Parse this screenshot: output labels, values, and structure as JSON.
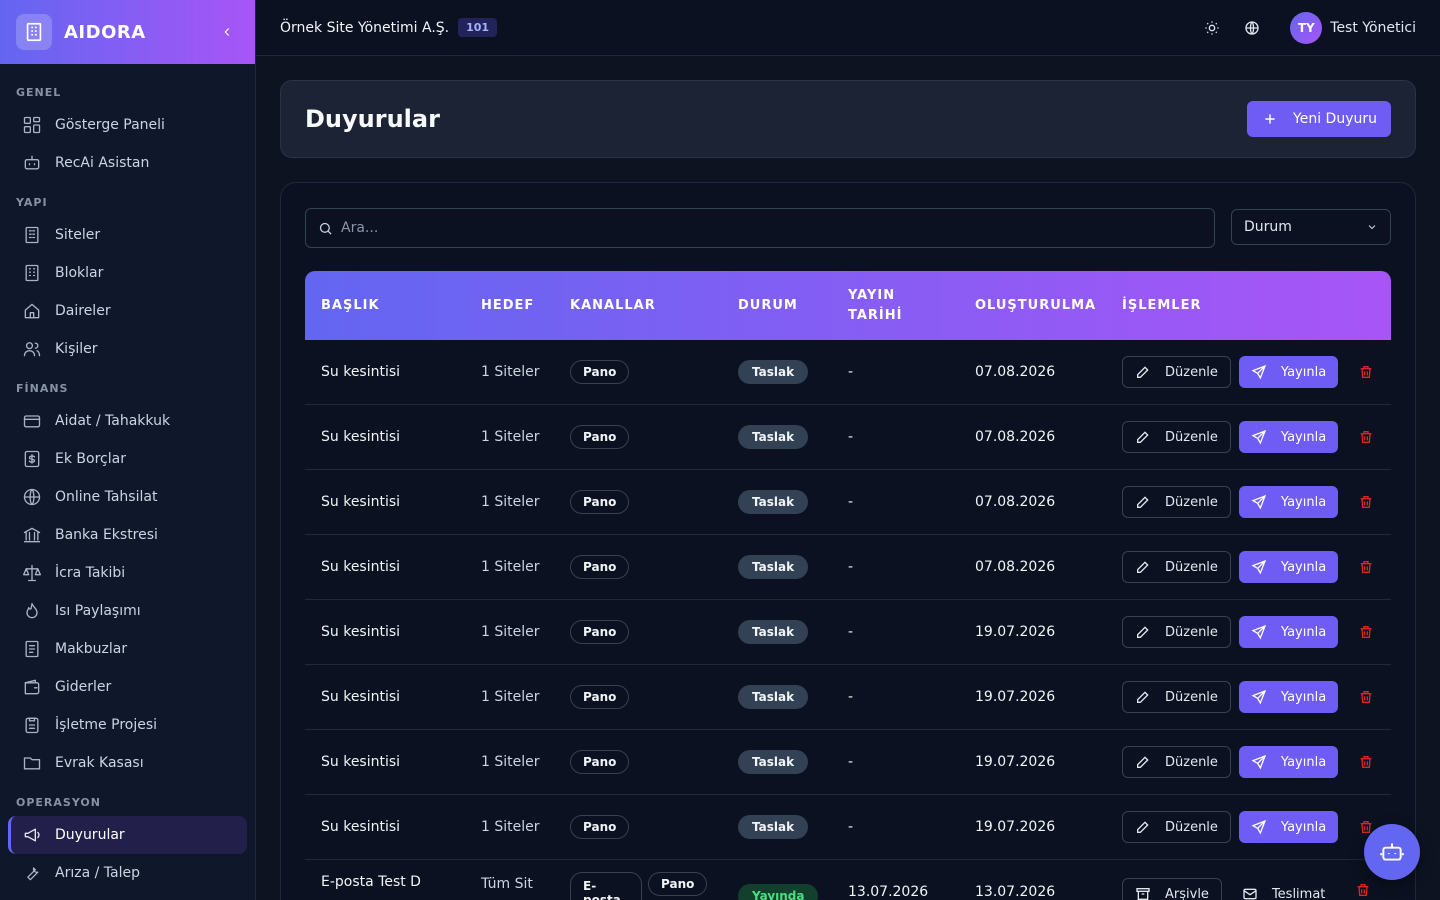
{
  "app": {
    "name": "AIDORA"
  },
  "sidebar": {
    "sections": [
      {
        "title": "GENEL",
        "items": [
          {
            "label": "Gösterge Paneli",
            "icon": "dashboard-icon"
          },
          {
            "label": "RecAi Asistan",
            "icon": "bot-icon"
          }
        ]
      },
      {
        "title": "YAPI",
        "items": [
          {
            "label": "Siteler",
            "icon": "building-icon"
          },
          {
            "label": "Bloklar",
            "icon": "block-icon"
          },
          {
            "label": "Daireler",
            "icon": "home-icon"
          },
          {
            "label": "Kişiler",
            "icon": "users-icon"
          }
        ]
      },
      {
        "title": "FİNANS",
        "items": [
          {
            "label": "Aidat / Tahakkuk",
            "icon": "card-icon"
          },
          {
            "label": "Ek Borçlar",
            "icon": "dollar-icon"
          },
          {
            "label": "Online Tahsilat",
            "icon": "globe-icon"
          },
          {
            "label": "Banka Ekstresi",
            "icon": "bank-icon"
          },
          {
            "label": "İcra Takibi",
            "icon": "scale-icon"
          },
          {
            "label": "Isı Paylaşımı",
            "icon": "flame-icon"
          },
          {
            "label": "Makbuzlar",
            "icon": "receipt-icon"
          },
          {
            "label": "Giderler",
            "icon": "wallet-icon"
          },
          {
            "label": "İşletme Projesi",
            "icon": "clipboard-icon"
          },
          {
            "label": "Evrak Kasası",
            "icon": "folder-icon"
          }
        ]
      },
      {
        "title": "OPERASYON",
        "items": [
          {
            "label": "Duyurular",
            "icon": "megaphone-icon",
            "active": true
          },
          {
            "label": "Arıza / Talep",
            "icon": "wrench-icon"
          }
        ]
      }
    ]
  },
  "topbar": {
    "org_name": "Örnek Site Yönetimi A.Ş.",
    "org_badge": "101",
    "user_initials": "TY",
    "user_name": "Test Yönetici"
  },
  "header": {
    "title": "Duyurular",
    "new_button": "Yeni Duyuru"
  },
  "filters": {
    "search_placeholder": "Ara...",
    "status_select": "Durum"
  },
  "table": {
    "columns": [
      "BAŞLIK",
      "HEDEF",
      "KANALLAR",
      "DURUM",
      "YAYIN TARİHİ",
      "OLUŞTURULMA",
      "İŞLEMLER"
    ],
    "rows": [
      {
        "title": "Su kesintisi",
        "target": "1 Siteler",
        "channels": [
          "Pano"
        ],
        "status": "Taslak",
        "publish_date": "-",
        "created": "07.08.2026",
        "actions": [
          "Düzenle",
          "Yayınla"
        ]
      },
      {
        "title": "Su kesintisi",
        "target": "1 Siteler",
        "channels": [
          "Pano"
        ],
        "status": "Taslak",
        "publish_date": "-",
        "created": "07.08.2026",
        "actions": [
          "Düzenle",
          "Yayınla"
        ]
      },
      {
        "title": "Su kesintisi",
        "target": "1 Siteler",
        "channels": [
          "Pano"
        ],
        "status": "Taslak",
        "publish_date": "-",
        "created": "07.08.2026",
        "actions": [
          "Düzenle",
          "Yayınla"
        ]
      },
      {
        "title": "Su kesintisi",
        "target": "1 Siteler",
        "channels": [
          "Pano"
        ],
        "status": "Taslak",
        "publish_date": "-",
        "created": "07.08.2026",
        "actions": [
          "Düzenle",
          "Yayınla"
        ]
      },
      {
        "title": "Su kesintisi",
        "target": "1 Siteler",
        "channels": [
          "Pano"
        ],
        "status": "Taslak",
        "publish_date": "-",
        "created": "19.07.2026",
        "actions": [
          "Düzenle",
          "Yayınla"
        ]
      },
      {
        "title": "Su kesintisi",
        "target": "1 Siteler",
        "channels": [
          "Pano"
        ],
        "status": "Taslak",
        "publish_date": "-",
        "created": "19.07.2026",
        "actions": [
          "Düzenle",
          "Yayınla"
        ]
      },
      {
        "title": "Su kesintisi",
        "target": "1 Siteler",
        "channels": [
          "Pano"
        ],
        "status": "Taslak",
        "publish_date": "-",
        "created": "19.07.2026",
        "actions": [
          "Düzenle",
          "Yayınla"
        ]
      },
      {
        "title": "Su kesintisi",
        "target": "1 Siteler",
        "channels": [
          "Pano"
        ],
        "status": "Taslak",
        "publish_date": "-",
        "created": "19.07.2026",
        "actions": [
          "Düzenle",
          "Yayınla"
        ]
      },
      {
        "title": "E-posta Test D",
        "target": "Tüm Sit",
        "channels": [
          "E-posta",
          "Pano"
        ],
        "status": "Yayında",
        "publish_date": "13.07.2026",
        "created": "13.07.2026",
        "actions": [
          "Arşivle",
          "Teslimat"
        ]
      }
    ]
  },
  "colors": {
    "accent": "#6f5cf5",
    "gradient_start": "#6366f1",
    "gradient_end": "#a855f7",
    "danger": "#dc2626",
    "success": "#4ade80"
  }
}
